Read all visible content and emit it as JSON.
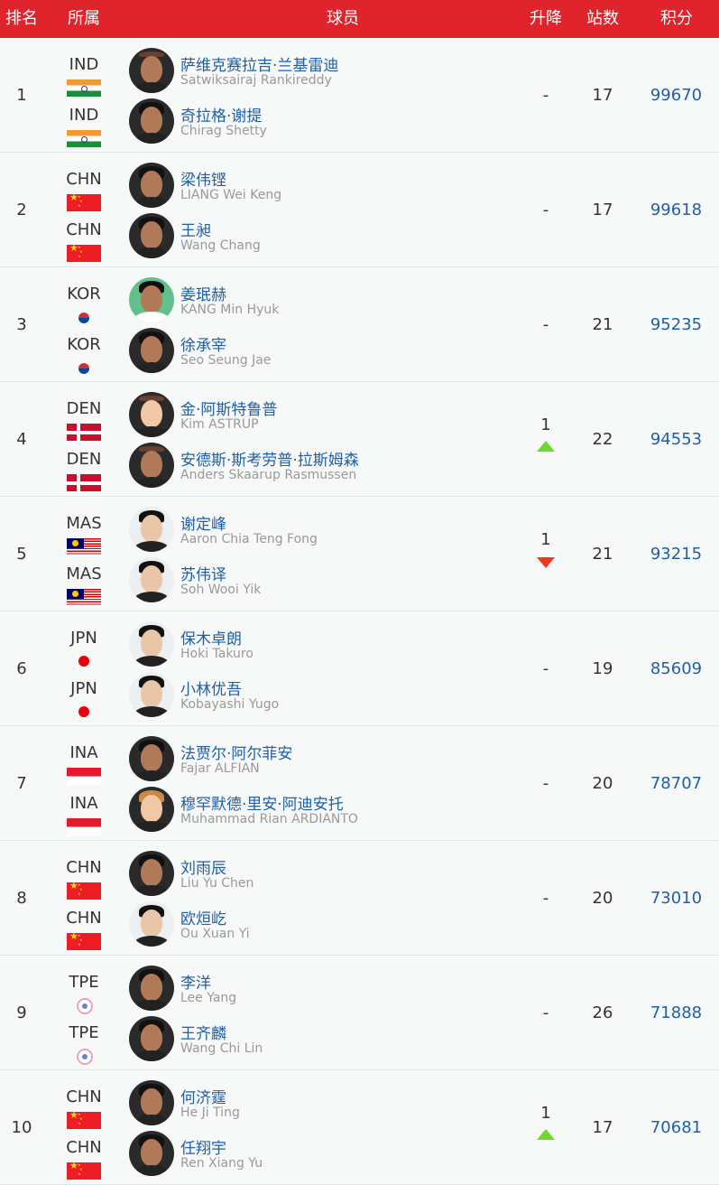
{
  "header": {
    "rank": "排名",
    "country": "所属",
    "players": "球员",
    "change": "升降",
    "events": "站数",
    "points": "积分"
  },
  "colors": {
    "header_bg": "#e0242b",
    "points_text": "#1f5fa8",
    "rise": "#6fd82e",
    "fall": "#f03a17"
  },
  "rows": [
    {
      "rank": "1",
      "change": "-",
      "change_dir": "none",
      "events": "17",
      "points": "99670",
      "players": [
        {
          "country": "IND",
          "flag": "india-flag",
          "name_cn": "萨维克赛拉吉·兰基雷迪",
          "name_en": "Satwiksairaj Rankireddy"
        },
        {
          "country": "IND",
          "flag": "india-flag",
          "name_cn": "奇拉格·谢提",
          "name_en": "Chirag Shetty"
        }
      ]
    },
    {
      "rank": "2",
      "change": "-",
      "change_dir": "none",
      "events": "17",
      "points": "99618",
      "players": [
        {
          "country": "CHN",
          "flag": "china-flag",
          "name_cn": "梁伟铿",
          "name_en": "LIANG Wei Keng"
        },
        {
          "country": "CHN",
          "flag": "china-flag",
          "name_cn": "王昶",
          "name_en": "Wang Chang"
        }
      ]
    },
    {
      "rank": "3",
      "change": "-",
      "change_dir": "none",
      "events": "21",
      "points": "95235",
      "players": [
        {
          "country": "KOR",
          "flag": "korea-flag",
          "name_cn": "姜珉赫",
          "name_en": "KANG Min Hyuk"
        },
        {
          "country": "KOR",
          "flag": "korea-flag",
          "name_cn": "徐承宰",
          "name_en": "Seo Seung Jae"
        }
      ]
    },
    {
      "rank": "4",
      "change": "1",
      "change_dir": "up",
      "events": "22",
      "points": "94553",
      "players": [
        {
          "country": "DEN",
          "flag": "denmark-flag",
          "name_cn": "金·阿斯特鲁普",
          "name_en": "Kim ASTRUP"
        },
        {
          "country": "DEN",
          "flag": "denmark-flag",
          "name_cn": "安德斯·斯考劳普·拉斯姆森",
          "name_en": "Anders Skaarup Rasmussen"
        }
      ]
    },
    {
      "rank": "5",
      "change": "1",
      "change_dir": "down",
      "events": "21",
      "points": "93215",
      "players": [
        {
          "country": "MAS",
          "flag": "malaysia-flag",
          "name_cn": "谢定峰",
          "name_en": "Aaron Chia Teng Fong"
        },
        {
          "country": "MAS",
          "flag": "malaysia-flag",
          "name_cn": "苏伟译",
          "name_en": "Soh Wooi Yik"
        }
      ]
    },
    {
      "rank": "6",
      "change": "-",
      "change_dir": "none",
      "events": "19",
      "points": "85609",
      "players": [
        {
          "country": "JPN",
          "flag": "japan-flag",
          "name_cn": "保木卓朗",
          "name_en": "Hoki Takuro"
        },
        {
          "country": "JPN",
          "flag": "japan-flag",
          "name_cn": "小林优吾",
          "name_en": "Kobayashi Yugo"
        }
      ]
    },
    {
      "rank": "7",
      "change": "-",
      "change_dir": "none",
      "events": "20",
      "points": "78707",
      "players": [
        {
          "country": "INA",
          "flag": "indonesia-flag",
          "name_cn": "法贾尔·阿尔菲安",
          "name_en": "Fajar ALFIAN"
        },
        {
          "country": "INA",
          "flag": "indonesia-flag",
          "name_cn": "穆罕默德·里安·阿迪安托",
          "name_en": "Muhammad Rian ARDIANTO"
        }
      ]
    },
    {
      "rank": "8",
      "change": "-",
      "change_dir": "none",
      "events": "20",
      "points": "73010",
      "players": [
        {
          "country": "CHN",
          "flag": "china-flag",
          "name_cn": "刘雨辰",
          "name_en": "Liu Yu Chen"
        },
        {
          "country": "CHN",
          "flag": "china-flag",
          "name_cn": "欧烜屹",
          "name_en": "Ou Xuan Yi"
        }
      ]
    },
    {
      "rank": "9",
      "change": "-",
      "change_dir": "none",
      "events": "26",
      "points": "71888",
      "players": [
        {
          "country": "TPE",
          "flag": "chinese-taipei-flag",
          "name_cn": "李洋",
          "name_en": "Lee Yang"
        },
        {
          "country": "TPE",
          "flag": "chinese-taipei-flag",
          "name_cn": "王齐麟",
          "name_en": "Wang Chi Lin"
        }
      ]
    },
    {
      "rank": "10",
      "change": "1",
      "change_dir": "up",
      "events": "17",
      "points": "70681",
      "players": [
        {
          "country": "CHN",
          "flag": "china-flag",
          "name_cn": "何济霆",
          "name_en": "He Ji Ting"
        },
        {
          "country": "CHN",
          "flag": "china-flag",
          "name_cn": "任翔宇",
          "name_en": "Ren Xiang Yu"
        }
      ]
    }
  ]
}
